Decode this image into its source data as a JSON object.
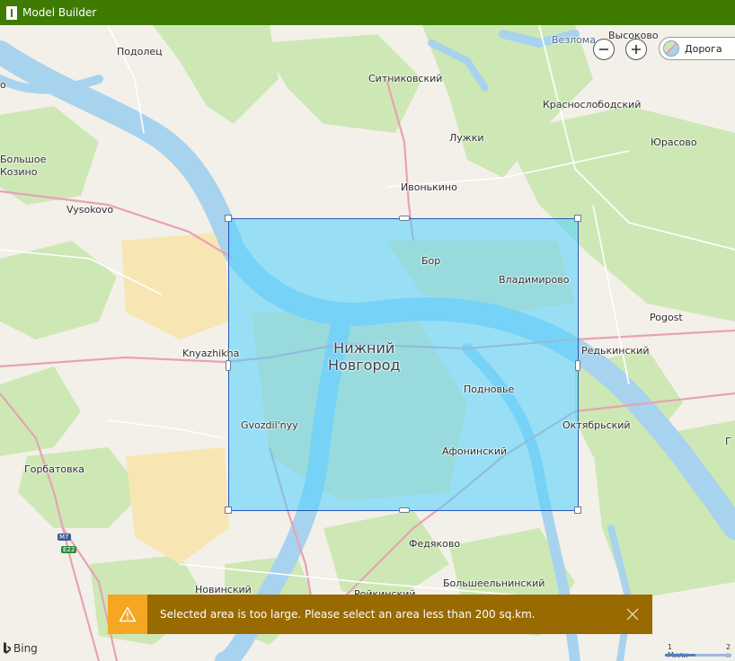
{
  "window": {
    "title": "Model Builder",
    "title_color": "#3f7b00"
  },
  "map": {
    "labels": {
      "podolets": "Подолец",
      "sitnikovskiy": "Ситниковский",
      "vezloma": "Везлома",
      "vysokovo_top": "Высоково",
      "krasnoslobodskiy": "Краснослободский",
      "luzhki": "Лужки",
      "yurasovo": "Юрасово",
      "bolshoe_kozino": "Большое\nКозино",
      "ivonkino": "Ивонькино",
      "vysokovo": "Vysokovo",
      "bor": "Бор",
      "vladimirovo": "Владимирово",
      "pogost": "Pogost",
      "knyazhikha": "Knyazhikha",
      "nizhniy_novgorod": "Нижний\nНовгород",
      "redkinskiy": "Редькинский",
      "podnovye": "Подновье",
      "oktyabrskiy": "Октябрьский",
      "gvozdilnyy": "Gvozdil'nyy",
      "afoninskiy": "Афонинский",
      "gorbatovka": "Горбатовка",
      "m7": "M7",
      "e22": "E22",
      "fedyakovo": "Федяково",
      "novinskiy": "Новинский",
      "bolsheelninskiy": "Большеельнинский",
      "roykinskiy": "Ройкинский",
      "g_right": "Г",
      "o_left": "о"
    },
    "map_style": "Дорога",
    "attribution": "Bing",
    "scale_labels": [
      "1 Мили",
      "2 к"
    ],
    "colors": {
      "land": "#f3f0e9",
      "forest": "#cde8b5",
      "water": "#a8d3ee",
      "road_major": "#e7a2b3",
      "road_minor": "#ffffff",
      "urban": "#f7e6b4",
      "selection_fill": "#4cd2ff",
      "selection_border": "#2a55b5"
    }
  },
  "controls": {
    "zoom_out": "zoom-out",
    "zoom_in": "zoom-in"
  },
  "toast": {
    "message": "Selected area is too large. Please select an area less than 200 sq.km.",
    "accent": "#f5a623",
    "background": "#986a00"
  }
}
